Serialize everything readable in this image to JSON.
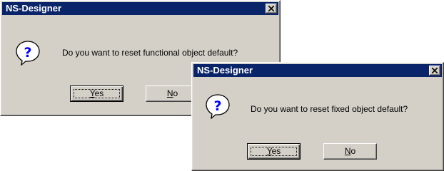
{
  "dialogs": [
    {
      "title": "NS-Designer",
      "message": "Do you want to reset functional object default?",
      "icon": "question-icon",
      "buttons": [
        {
          "mnemonic": "Y",
          "rest": "es",
          "is_default": true
        },
        {
          "mnemonic": "N",
          "rest": "o",
          "is_default": false
        }
      ]
    },
    {
      "title": "NS-Designer",
      "message": "Do you want to reset fixed object default?",
      "icon": "question-icon",
      "buttons": [
        {
          "mnemonic": "Y",
          "rest": "es",
          "is_default": true
        },
        {
          "mnemonic": "N",
          "rest": "o",
          "is_default": false
        }
      ]
    }
  ],
  "colors": {
    "titlebar": "#0a246a",
    "face": "#d4d0c8",
    "icon_blue": "#0000ff"
  }
}
